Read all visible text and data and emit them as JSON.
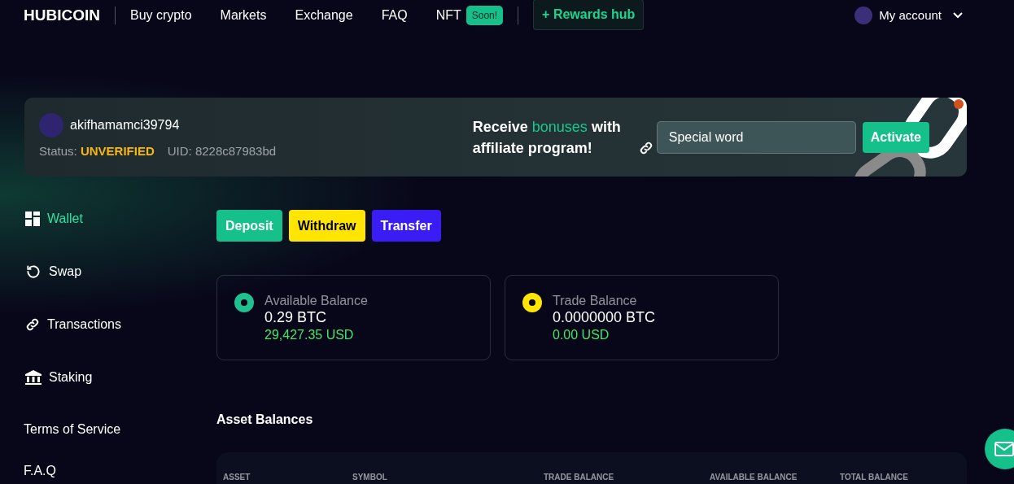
{
  "nav": {
    "logo": "HUBICOIN",
    "links": [
      {
        "label": "Buy crypto"
      },
      {
        "label": "Markets"
      },
      {
        "label": "Exchange"
      },
      {
        "label": "FAQ"
      },
      {
        "label": "NFT",
        "badge": "Soon!"
      }
    ],
    "rewards": "+ Rewards hub",
    "account": "My account"
  },
  "banner": {
    "username": "akifhamamci39794",
    "status_label": "Status:",
    "status": "UNVERIFIED",
    "uid": "UID: 8228c87983bd",
    "promo": "Receive **bonuses** with affiliate program!",
    "input_placeholder": "Special word",
    "activate": "Activate"
  },
  "sidebar": {
    "items": [
      {
        "label": "Wallet",
        "selected": true
      },
      {
        "label": "Swap",
        "selected": false
      },
      {
        "label": "Transactions",
        "selected": false
      },
      {
        "label": "Staking",
        "selected": false
      }
    ],
    "links": [
      "Terms of Service",
      "F.A.Q"
    ]
  },
  "actions": [
    {
      "label": "Deposit",
      "color": "#16c08a"
    },
    {
      "label": "Withdraw",
      "color": "#ffe500"
    },
    {
      "label": "Transfer",
      "color": "#3a1cf5"
    }
  ],
  "balances": [
    {
      "label": "Available Balance",
      "amount": "0.29 BTC",
      "usd": "29,427.35 USD",
      "color": "#1fc08e"
    },
    {
      "label": "Trade Balance",
      "amount": "0.0000000 BTC",
      "usd": "0.00 USD",
      "color": "#ffe500"
    }
  ],
  "assets": {
    "title": "Asset Balances",
    "columns": [
      "ASSET",
      "SYMBOL",
      "TRADE BALANCE",
      "AVAILABLE BALANCE",
      "TOTAL BALANCE"
    ]
  }
}
